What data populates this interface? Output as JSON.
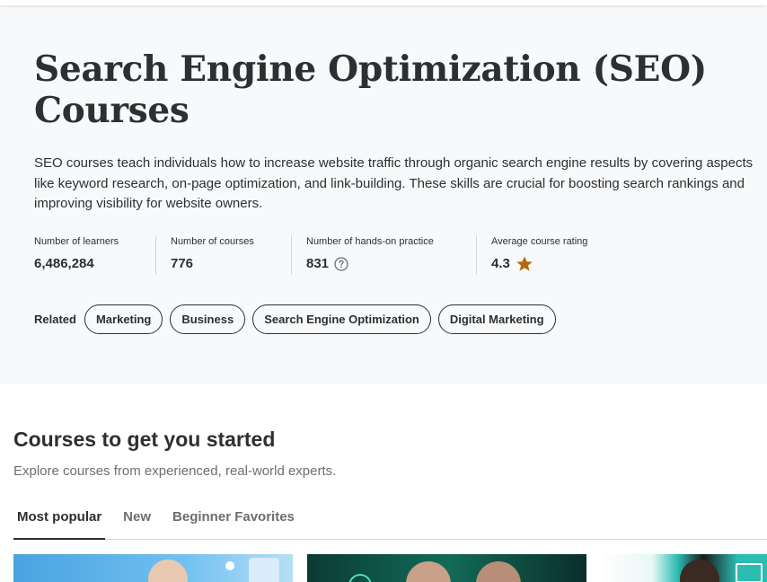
{
  "hero": {
    "title": "Search Engine Optimization (SEO) Courses",
    "description": "SEO courses teach individuals how to increase website traffic through organic search engine results by covering aspects like keyword research, on-page optimization, and link-building. These skills are crucial for boosting search rankings and improving visibility for website owners.",
    "stats": [
      {
        "label": "Number of learners",
        "value": "6,486,284"
      },
      {
        "label": "Number of courses",
        "value": "776"
      },
      {
        "label": "Number of hands-on practice",
        "value": "831",
        "icon": "help-circle-icon"
      },
      {
        "label": "Average course rating",
        "value": "4.3",
        "icon": "star-icon"
      }
    ],
    "related_label": "Related",
    "related_topics": [
      "Marketing",
      "Business",
      "Search Engine Optimization",
      "Digital Marketing"
    ]
  },
  "courses_section": {
    "title": "Courses to get you started",
    "subtitle": "Explore courses from experienced, real-world experts.",
    "tabs": [
      {
        "label": "Most popular",
        "active": true
      },
      {
        "label": "New",
        "active": false
      },
      {
        "label": "Beginner Favorites",
        "active": false
      }
    ]
  },
  "colors": {
    "hero_background": "#f7f9fa",
    "text": "#2d2f31",
    "muted_text": "#6a6f73",
    "star": "#b4690e",
    "border": "#d1d7dc"
  }
}
